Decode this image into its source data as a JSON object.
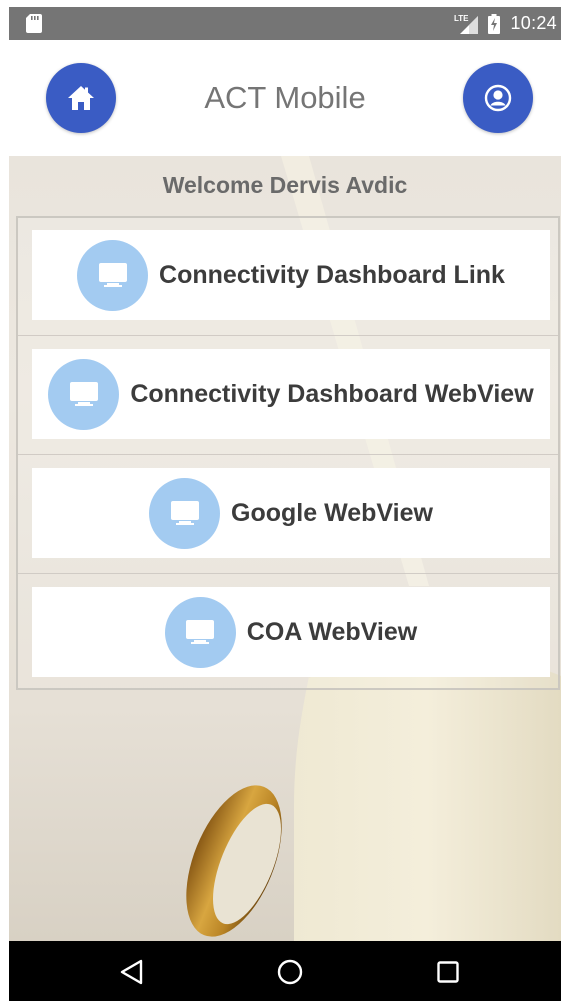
{
  "status_bar": {
    "network_label": "LTE",
    "time": "10:24",
    "background": "#757575"
  },
  "header": {
    "title": "ACT Mobile",
    "home_icon": "home-icon",
    "profile_icon": "user-icon",
    "accent": "#3a5cc4"
  },
  "welcome": {
    "text": "Welcome Dervis Avdic"
  },
  "menu": {
    "items": [
      {
        "label": "Connectivity Dashboard Link",
        "icon": "monitor-icon"
      },
      {
        "label": "Connectivity Dashboard WebView",
        "icon": "monitor-icon"
      },
      {
        "label": "Google WebView",
        "icon": "monitor-icon"
      },
      {
        "label": "COA WebView",
        "icon": "monitor-icon"
      }
    ],
    "icon_color": "#a3cbf1"
  },
  "nav_bar": {
    "back_icon": "back-triangle-icon",
    "home_icon": "home-circle-icon",
    "recents_icon": "recents-square-icon"
  }
}
